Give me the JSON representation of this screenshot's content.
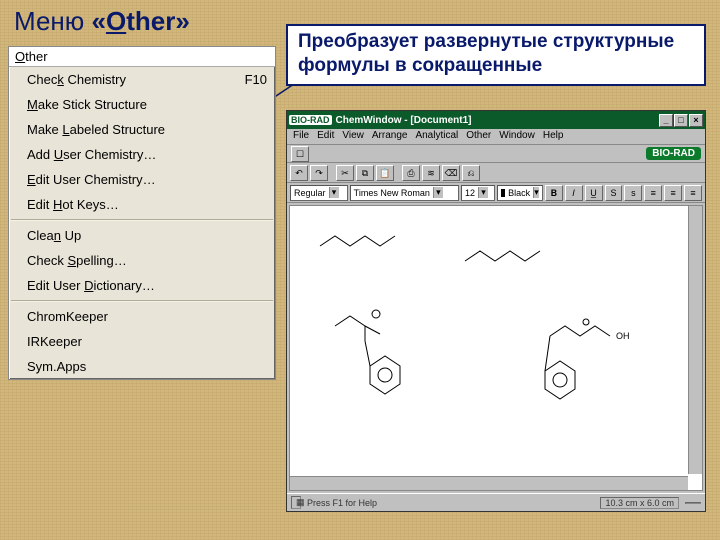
{
  "slide": {
    "title_prefix": "Меню ",
    "title_quote_open": "«",
    "title_word_pre": "O",
    "title_word_rest": "ther",
    "title_quote_close": "»",
    "callout": "Преобразует развернутые структурные формулы в сокращенные"
  },
  "menu": {
    "title_pre": "O",
    "title_rest": "ther",
    "items": [
      {
        "pre": "Chec",
        "u": "k",
        "post": " Chemistry",
        "shortcut": "F10"
      },
      {
        "pre": "",
        "u": "M",
        "post": "ake Stick Structure",
        "shortcut": ""
      },
      {
        "pre": "Make ",
        "u": "L",
        "post": "abeled Structure",
        "shortcut": ""
      },
      {
        "pre": "Add ",
        "u": "U",
        "post": "ser Chemistry…",
        "shortcut": ""
      },
      {
        "pre": "",
        "u": "E",
        "post": "dit User Chemistry…",
        "shortcut": ""
      },
      {
        "pre": "Edit ",
        "u": "H",
        "post": "ot Keys…",
        "shortcut": ""
      }
    ],
    "group2": [
      {
        "pre": "Clea",
        "u": "n",
        "post": " Up",
        "shortcut": ""
      },
      {
        "pre": "Check ",
        "u": "S",
        "post": "pelling…",
        "shortcut": ""
      },
      {
        "pre": "Edit User ",
        "u": "D",
        "post": "ictionary…",
        "shortcut": ""
      }
    ],
    "group3": [
      {
        "pre": "ChromKeeper",
        "u": "",
        "post": "",
        "shortcut": ""
      },
      {
        "pre": "IRKeeper",
        "u": "",
        "post": "",
        "shortcut": ""
      },
      {
        "pre": "Sym.Apps",
        "u": "",
        "post": "",
        "shortcut": ""
      }
    ]
  },
  "app": {
    "logo": "BIO-RAD",
    "title": "ChemWindow - [Document1]",
    "menubar": [
      "File",
      "Edit",
      "View",
      "Arrange",
      "Analytical",
      "Other",
      "Window",
      "Help"
    ],
    "brand": "BIO-RAD",
    "font_style": "Regular",
    "font_name": "Times New Roman",
    "font_size": "12",
    "font_color": "Black",
    "status_left": "Press F1 for Help",
    "status_right": "10.3 cm x 6.0 cm",
    "winbtns": {
      "min": "_",
      "max": "□",
      "close": "×"
    },
    "toolbar_icons": [
      "↶",
      "↷",
      "✂",
      "⧉",
      "📋",
      "⎙",
      "≋",
      "⌫",
      "⎌",
      "𝐁",
      "𝐼",
      "U̲",
      "S",
      "s",
      "≡",
      "≡",
      "≡"
    ]
  }
}
